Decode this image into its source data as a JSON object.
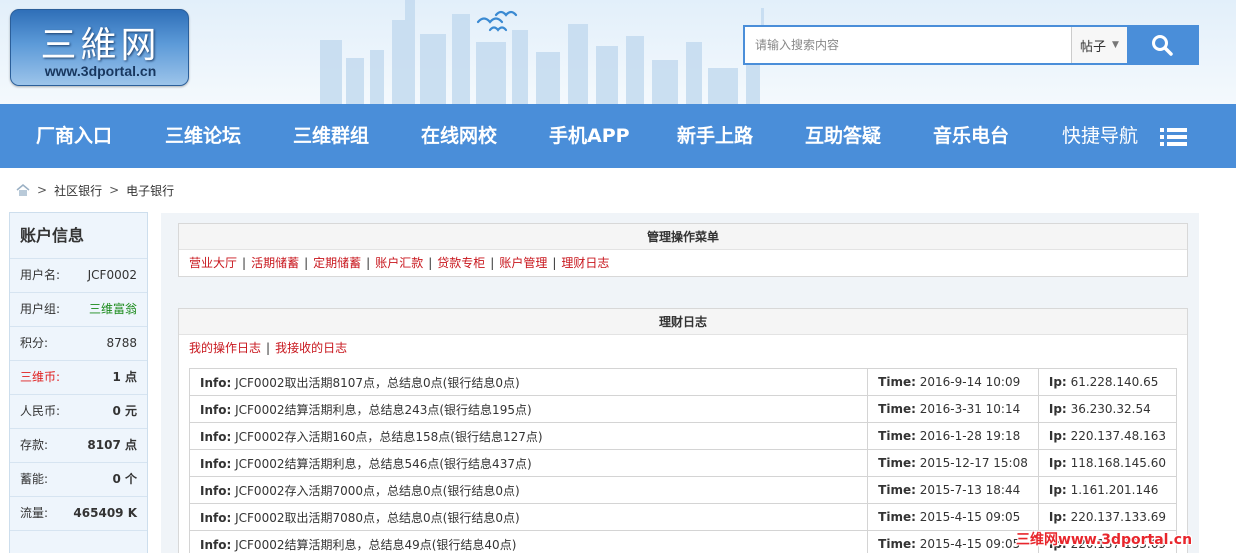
{
  "header": {
    "logo_cn": "三維网",
    "logo_url": "www.3dportal.cn",
    "search": {
      "placeholder": "请输入搜索内容",
      "type_label": "帖子",
      "button_icon": "search-icon"
    }
  },
  "nav": {
    "items": [
      "厂商入口",
      "三维论坛",
      "三维群组",
      "在线网校",
      "手机APP",
      "新手上路",
      "互助答疑",
      "音乐电台",
      "快捷导航"
    ],
    "menu_icon": "menu-icon"
  },
  "breadcrumb": {
    "home_icon": "home-icon",
    "sep": ">",
    "items": [
      "社区银行",
      "电子银行"
    ]
  },
  "sidebar": {
    "title": "账户信息",
    "rows": [
      {
        "label": "用户名:",
        "value": "JCF0002"
      },
      {
        "label": "用户组:",
        "value": "三维富翁"
      },
      {
        "label": "积分:",
        "value": "8788"
      },
      {
        "label": "三维币:",
        "value": "1 点"
      },
      {
        "label": "人民币:",
        "value": "0 元"
      },
      {
        "label": "存款:",
        "value": "8107 点"
      },
      {
        "label": "蓄能:",
        "value": "0 个"
      },
      {
        "label": "流量:",
        "value": "465409 K"
      }
    ]
  },
  "menu_panel": {
    "title": "管理操作菜单",
    "links": [
      "营业大厅",
      "活期储蓄",
      "定期储蓄",
      "账户汇款",
      "贷款专柜",
      "账户管理",
      "理财日志"
    ],
    "separator": "|"
  },
  "log_panel": {
    "title": "理财日志",
    "tabs": [
      "我的操作日志",
      "我接收的日志"
    ],
    "labels": {
      "info": "Info:",
      "time": "Time:",
      "ip": "Ip:"
    },
    "rows": [
      {
        "info": "JCF0002取出活期8107点，总结息0点(银行结息0点)",
        "time": "2016-9-14 10:09",
        "ip": "61.228.140.65"
      },
      {
        "info": "JCF0002结算活期利息，总结息243点(银行结息195点)",
        "time": "2016-3-31 10:14",
        "ip": "36.230.32.54"
      },
      {
        "info": "JCF0002存入活期160点，总结息158点(银行结息127点)",
        "time": "2016-1-28 19:18",
        "ip": "220.137.48.163"
      },
      {
        "info": "JCF0002结算活期利息，总结息546点(银行结息437点)",
        "time": "2015-12-17 15:08",
        "ip": "118.168.145.60"
      },
      {
        "info": "JCF0002存入活期7000点，总结息0点(银行结息0点)",
        "time": "2015-7-13 18:44",
        "ip": "1.161.201.146"
      },
      {
        "info": "JCF0002取出活期7080点，总结息0点(银行结息0点)",
        "time": "2015-4-15 09:05",
        "ip": "220.137.133.69"
      },
      {
        "info": "JCF0002结算活期利息，总结息49点(银行结息40点)",
        "time": "2015-4-15 09:05",
        "ip": "220.137.133.69"
      }
    ]
  },
  "watermark": "三维网www.3dportal.cn",
  "colors": {
    "nav_blue": "#4a8ed9",
    "link_red": "#c8161d",
    "vip_green": "#1a8a1a",
    "accent_red": "#e02020"
  }
}
